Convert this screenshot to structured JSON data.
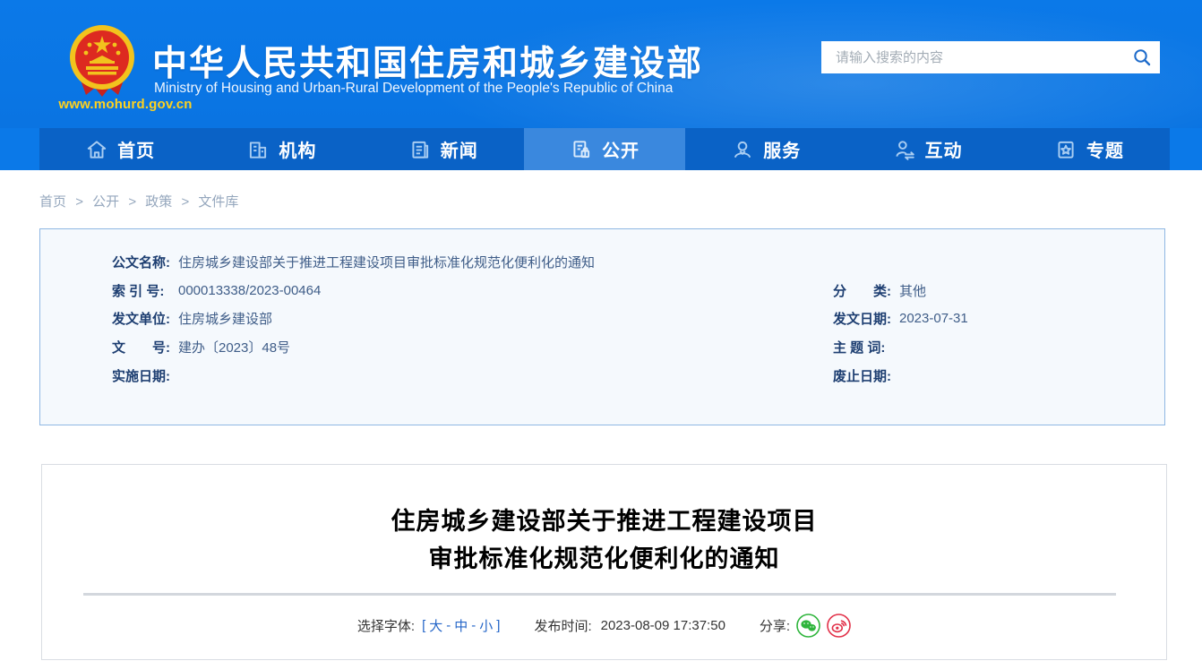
{
  "header": {
    "site_url": "www.mohurd.gov.cn",
    "title_zh": "中华人民共和国住房和城乡建设部",
    "title_en": "Ministry of Housing and Urban-Rural Development of the People's Republic of China",
    "search": {
      "placeholder": "请输入搜索的内容"
    }
  },
  "nav": {
    "items": [
      {
        "label": "首页",
        "icon": "home-icon",
        "active": false
      },
      {
        "label": "机构",
        "icon": "organization-icon",
        "active": false
      },
      {
        "label": "新闻",
        "icon": "news-icon",
        "active": false
      },
      {
        "label": "公开",
        "icon": "disclosure-icon",
        "active": true
      },
      {
        "label": "服务",
        "icon": "service-icon",
        "active": false
      },
      {
        "label": "互动",
        "icon": "interaction-icon",
        "active": false
      },
      {
        "label": "专题",
        "icon": "topics-icon",
        "active": false
      }
    ]
  },
  "breadcrumb": {
    "separator": ">",
    "items": [
      "首页",
      "公开",
      "政策",
      "文件库"
    ]
  },
  "doc_info": {
    "left": [
      {
        "label": "公文名称:",
        "value": "住房城乡建设部关于推进工程建设项目审批标准化规范化便利化的通知"
      },
      {
        "label": "索 引 号:",
        "value": "000013338/2023-00464"
      },
      {
        "label": "发文单位:",
        "value": "住房城乡建设部"
      },
      {
        "label": "文　　号:",
        "value": "建办〔2023〕48号"
      },
      {
        "label": "实施日期:",
        "value": ""
      }
    ],
    "right": [
      {
        "label": "分　　类:",
        "value": "其他"
      },
      {
        "label": "发文日期:",
        "value": "2023-07-31"
      },
      {
        "label": "主 题 词:",
        "value": ""
      },
      {
        "label": "废止日期:",
        "value": ""
      }
    ]
  },
  "article": {
    "title_line1": "住房城乡建设部关于推进工程建设项目",
    "title_line2": "审批标准化规范化便利化的通知",
    "font_selector": {
      "label": "选择字体:",
      "open_bracket": "[",
      "sizes": [
        "大",
        "中",
        "小"
      ],
      "separator": "-",
      "close_bracket": "]"
    },
    "publish_label": "发布时间:",
    "publish_time": "2023-08-09 17:37:50",
    "share_label": "分享:",
    "share_icons": [
      "wechat-icon",
      "weibo-icon"
    ]
  },
  "colors": {
    "header_blue": "#0b79e8",
    "nav_blue": "#0a62c6",
    "nav_active_blue": "#3a88de",
    "accent_yellow": "#ffd21e",
    "link_blue": "#2566c8",
    "wechat_green": "#2fb53c",
    "weibo_red": "#e23149"
  }
}
